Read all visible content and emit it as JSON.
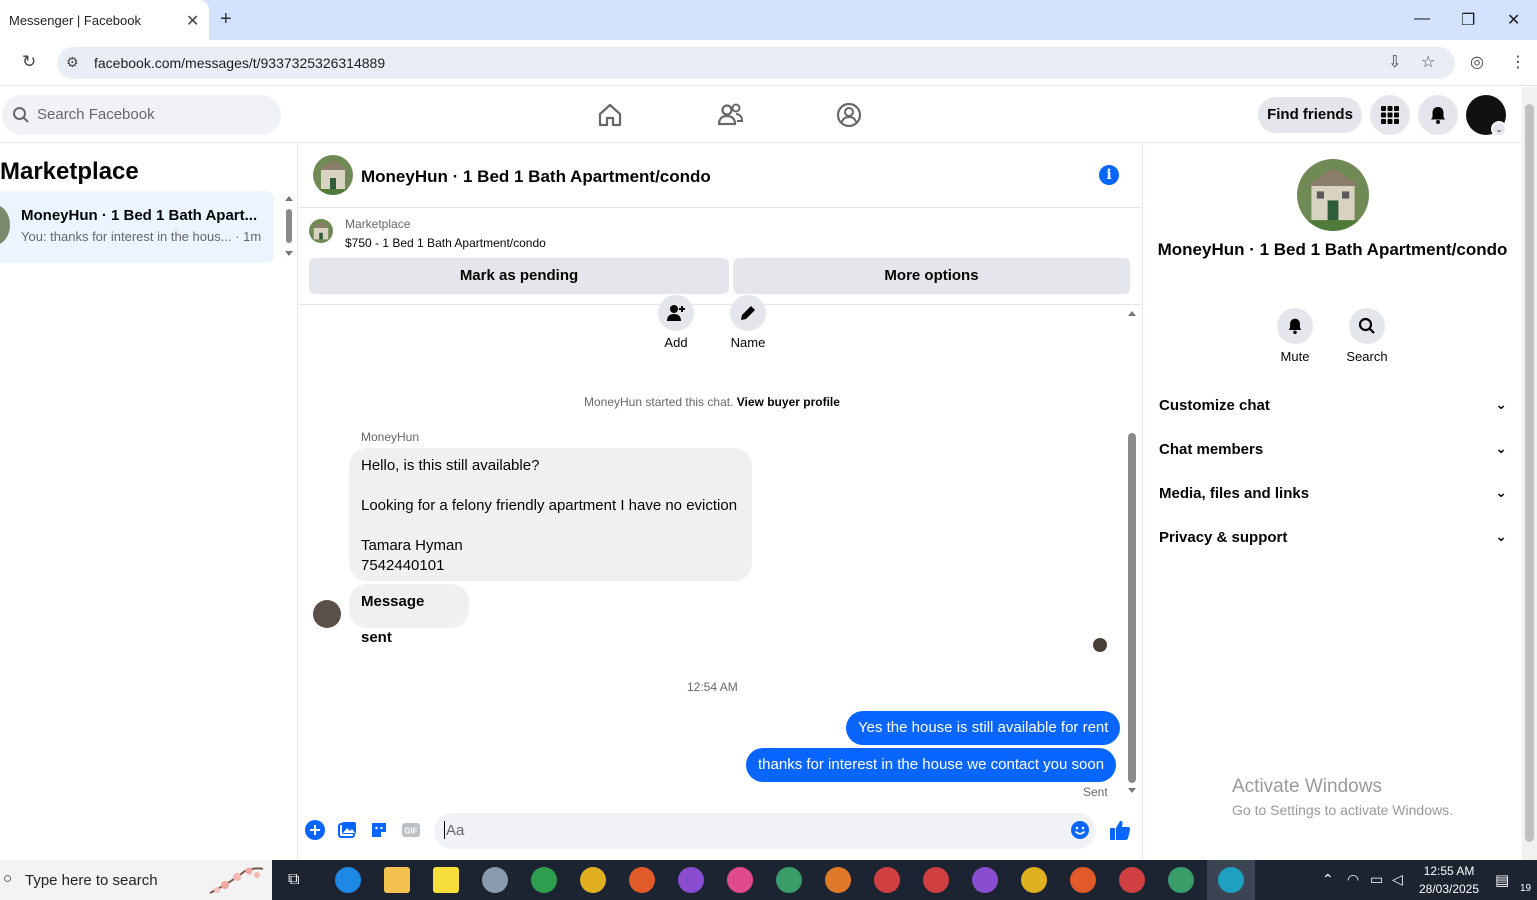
{
  "browser": {
    "tab_title": "Messenger | Facebook",
    "url": "facebook.com/messages/t/9337325326314889"
  },
  "header": {
    "search_placeholder": "Search Facebook",
    "find_friends": "Find friends"
  },
  "sidebar": {
    "title": "Marketplace",
    "conversations": [
      {
        "name": "MoneyHun · 1 Bed 1 Bath Apart...",
        "preview": "You: thanks for interest in the hous... · 1m"
      }
    ]
  },
  "chat": {
    "title": "MoneyHun · 1 Bed 1 Bath Apartment/condo",
    "marketplace_label": "Marketplace",
    "listing": "$750 - 1 Bed 1 Bath Apartment/condo",
    "mark_pending": "Mark as pending",
    "more_options": "More options",
    "actions": [
      {
        "label": "Add"
      },
      {
        "label": "Name"
      }
    ],
    "started_text": "MoneyHun started this chat.",
    "view_buyer": "View buyer profile",
    "sender": "MoneyHun",
    "incoming": {
      "line1": "Hello, is this still available?",
      "line2": "Looking for a felony friendly apartment I have no eviction",
      "line3": "Tamara Hyman",
      "line4": "7542440101"
    },
    "incoming2": "Message sent",
    "timestamp": "12:54 AM",
    "outgoing": [
      "Yes the house is still available for rent",
      "thanks for interest in the house we contact you soon"
    ],
    "sent_status": "Sent",
    "composer_placeholder": "Aa"
  },
  "right_panel": {
    "name": "MoneyHun · 1 Bed 1 Bath Apartment/condo",
    "mute": "Mute",
    "search": "Search",
    "sections": [
      "Customize chat",
      "Chat members",
      "Media, files and links",
      "Privacy & support"
    ]
  },
  "watermark": {
    "line1": "Activate Windows",
    "line2": "Go to Settings to activate Windows."
  },
  "taskbar": {
    "search_placeholder": "Type here to search",
    "time": "12:55 AM",
    "date": "28/03/2025",
    "notification_count": "19"
  },
  "colors": {
    "brand": "#0866ff",
    "bubble_in": "#f0f0f0",
    "tab_bar": "#d3e3fd"
  }
}
